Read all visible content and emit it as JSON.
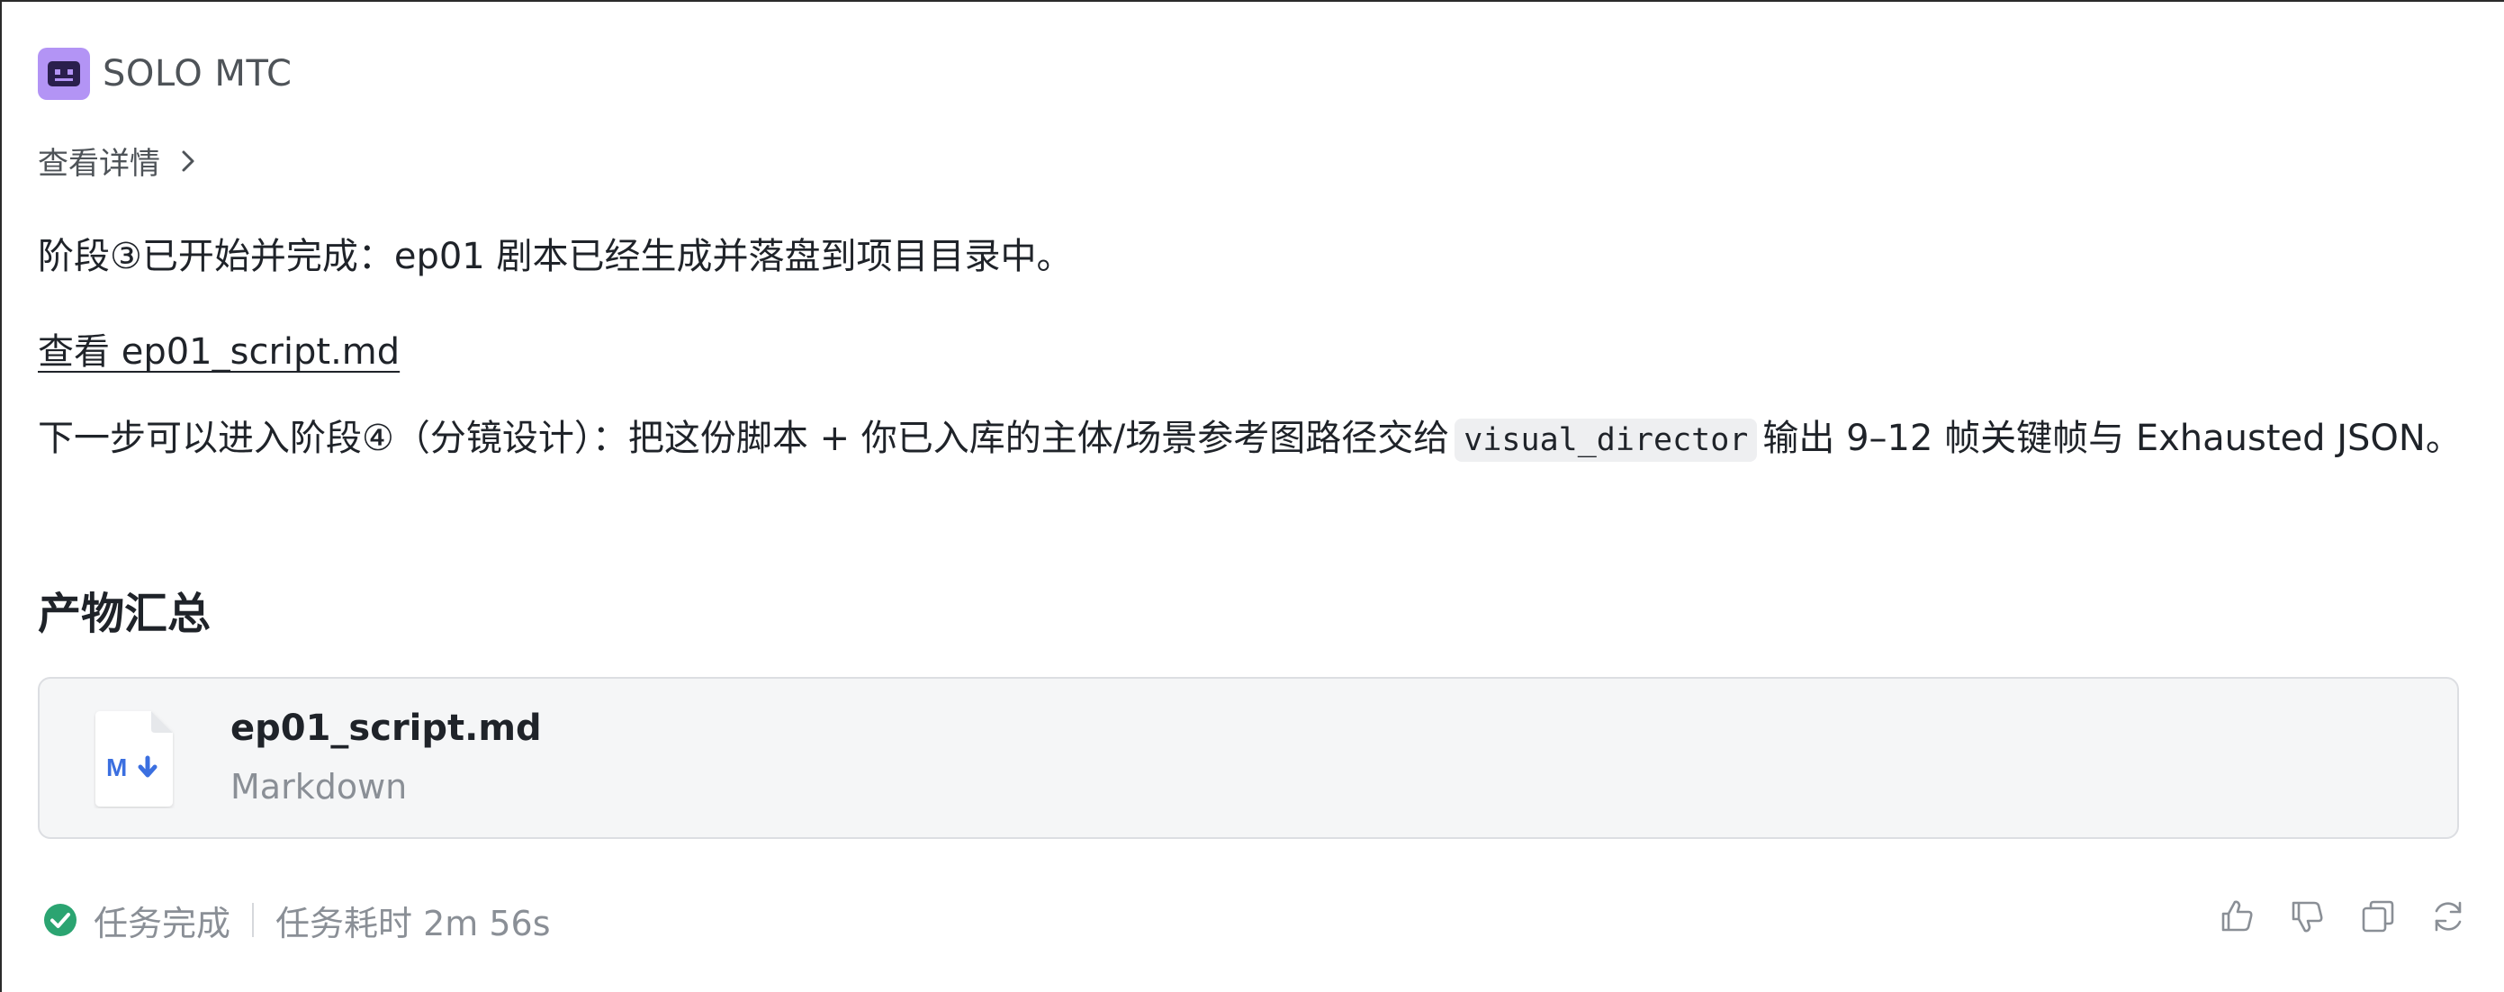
{
  "header": {
    "app_name": "SOLO MTC",
    "badge_color": "#b394f5"
  },
  "details": {
    "label": "查看详情",
    "icon": "chevron-right-icon"
  },
  "message": {
    "paragraph1": "阶段③已开始并完成：ep01 剧本已经生成并落盘到项目目录中。",
    "link_label": "查看 ep01_script.md",
    "paragraph2_prefix": "下一步可以进入阶段④（分镜设计）：把这份脚本 + 你已入库的主体/场景参考图路径交给",
    "paragraph2_code": "visual_director",
    "paragraph2_suffix": "输出 9–12 帧关键帧与 Exhausted JSON。"
  },
  "artifacts": {
    "heading": "产物汇总",
    "files": [
      {
        "name": "ep01_script.md",
        "type": "Markdown",
        "icon": "markdown-file-icon"
      }
    ]
  },
  "footer": {
    "status": "任务完成",
    "status_icon": "check-circle-icon",
    "status_color": "#2ba471",
    "duration": "任务耗时 2m 56s"
  },
  "actions": [
    {
      "name": "like",
      "icon": "thumbs-up-icon"
    },
    {
      "name": "dislike",
      "icon": "thumbs-down-icon"
    },
    {
      "name": "copy",
      "icon": "copy-icon"
    },
    {
      "name": "regenerate",
      "icon": "refresh-icon"
    }
  ]
}
